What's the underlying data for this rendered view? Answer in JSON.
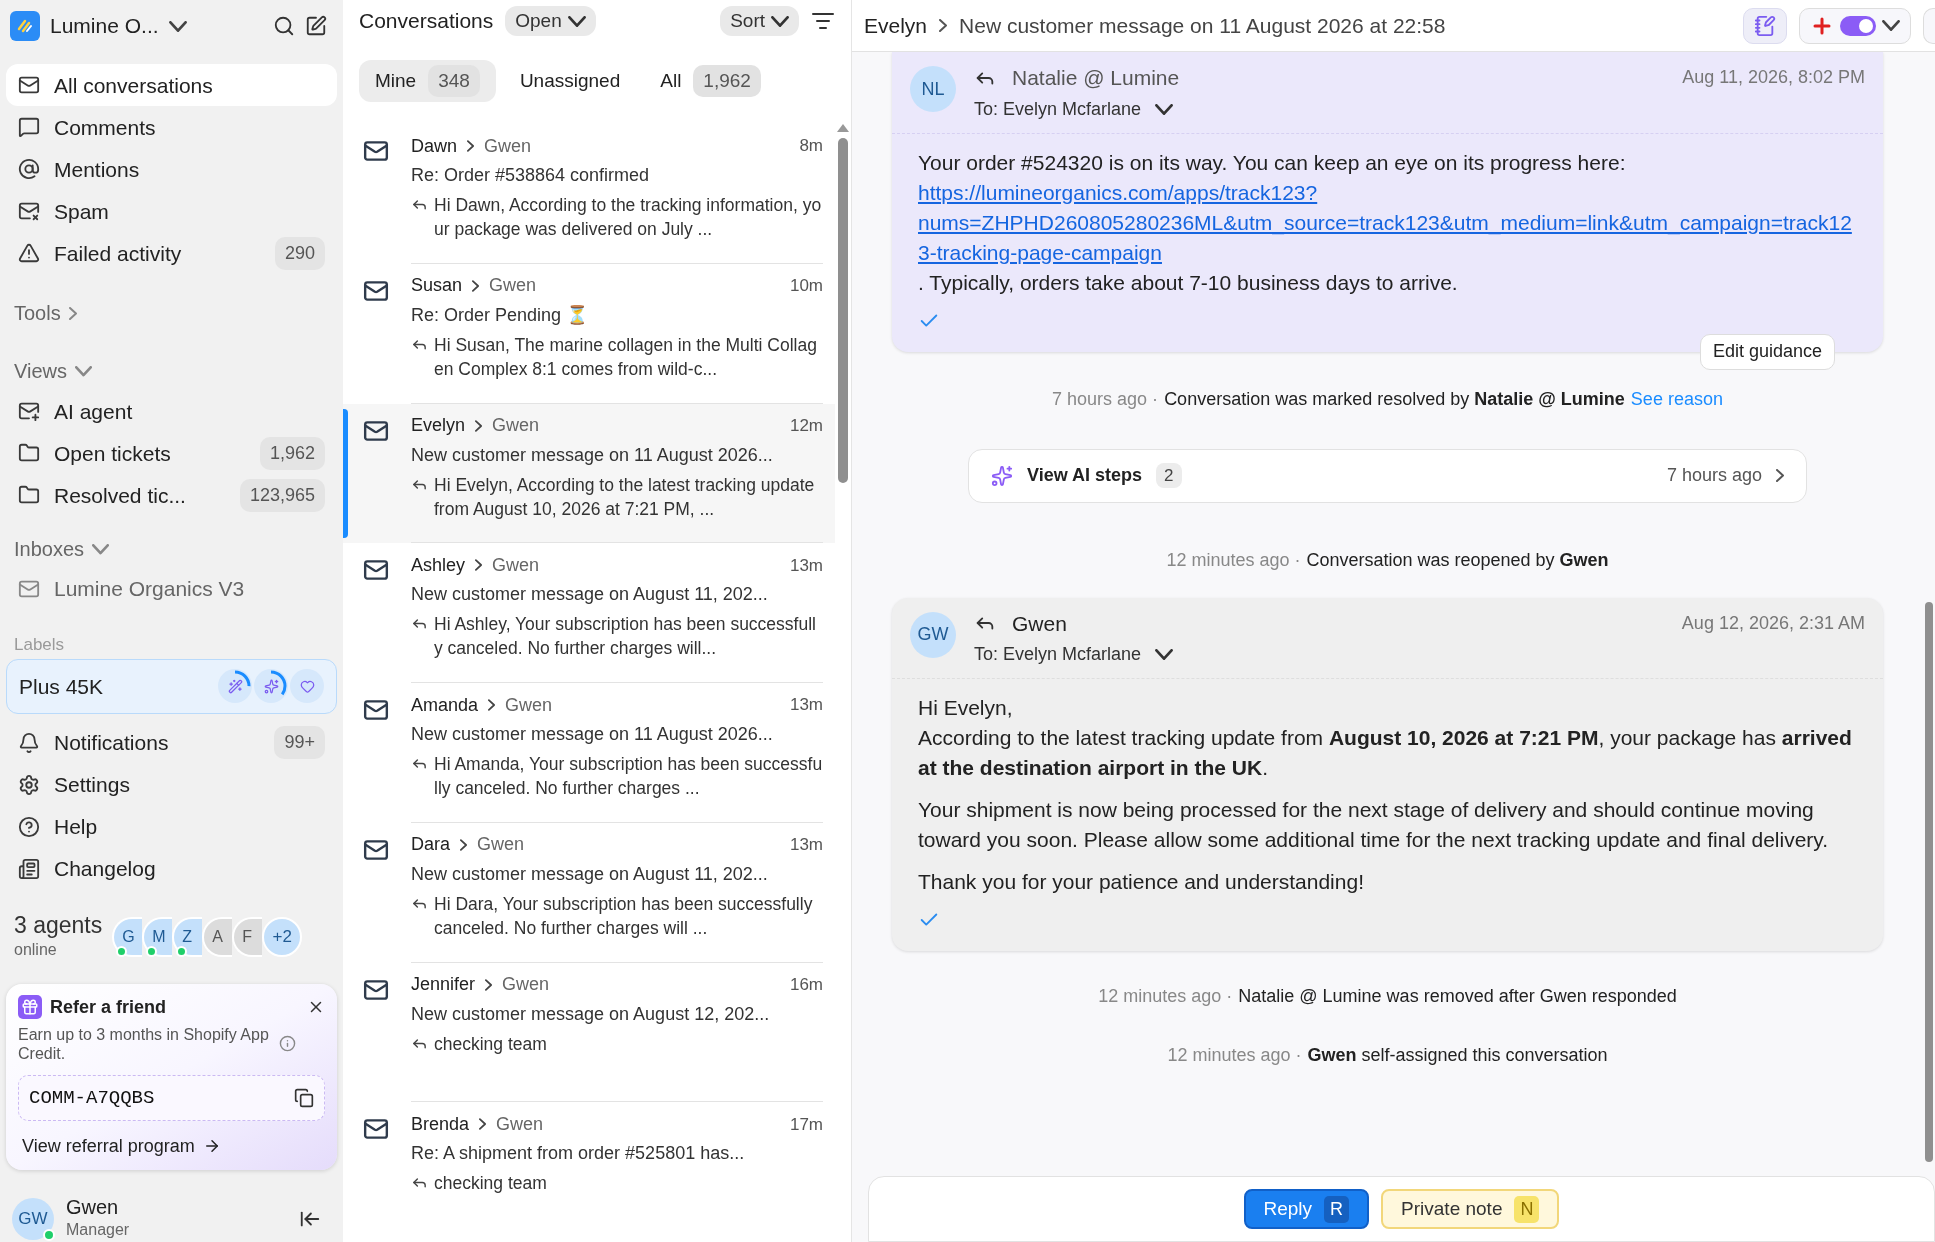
{
  "workspace": {
    "name": "Lumine O..."
  },
  "nav": [
    {
      "kind": "all",
      "label": "All conversations",
      "selected": true
    },
    {
      "kind": "comments",
      "label": "Comments",
      "selected": false
    },
    {
      "kind": "mentions",
      "label": "Mentions",
      "selected": false
    },
    {
      "kind": "spam",
      "label": "Spam",
      "selected": false
    },
    {
      "kind": "failed",
      "label": "Failed activity",
      "count": "290",
      "selected": false
    }
  ],
  "tools": {
    "label": "Tools"
  },
  "views": {
    "label": "Views",
    "items": [
      {
        "kind": "ai",
        "label": "AI agent"
      },
      {
        "kind": "folder",
        "label": "Open tickets",
        "count": "1,962"
      },
      {
        "kind": "folder",
        "label": "Resolved tic...",
        "count": "123,965"
      }
    ]
  },
  "inboxes": {
    "label": "Inboxes",
    "items": [
      {
        "label": "Lumine Organics V3"
      }
    ]
  },
  "labels": {
    "label": "Labels"
  },
  "plan": {
    "label": "Plus 45K"
  },
  "bottom_nav": [
    {
      "kind": "bell",
      "label": "Notifications",
      "count": "99+"
    },
    {
      "kind": "gear",
      "label": "Settings"
    },
    {
      "kind": "help",
      "label": "Help"
    },
    {
      "kind": "changelog",
      "label": "Changelog"
    }
  ],
  "agents": {
    "count": "3 agents",
    "status": "online",
    "avatars": [
      {
        "initials": "G",
        "online": true
      },
      {
        "initials": "M",
        "online": true
      },
      {
        "initials": "Z",
        "online": true
      },
      {
        "initials": "A",
        "online": false
      },
      {
        "initials": "F",
        "online": false
      }
    ],
    "more": "+2"
  },
  "referral": {
    "title": "Refer a friend",
    "text": "Earn up to 3 months in Shopify App Credit.",
    "code": "COMM-A7QQBS",
    "link": "View referral program"
  },
  "user": {
    "initials": "GW",
    "name": "Gwen",
    "role": "Manager",
    "online": true
  },
  "list": {
    "title": "Conversations",
    "status": "Open",
    "sort": "Sort",
    "tabs": [
      {
        "label": "Mine",
        "count": "348",
        "selected": true
      },
      {
        "label": "Unassigned",
        "selected": false
      },
      {
        "label": "All",
        "count": "1,962",
        "selected": false
      }
    ],
    "conversations": [
      {
        "from": "Dawn",
        "to": "Gwen",
        "time": "8m",
        "subject": "Re: Order #538864 confirmed",
        "preview": "Hi Dawn, According to the tracking information, your package was delivered on July ...",
        "selected": false
      },
      {
        "from": "Susan",
        "to": "Gwen",
        "time": "10m",
        "subject": "Re: Order Pending ⏳",
        "preview": "Hi Susan, The marine collagen in the Multi Collagen Complex 8:1 comes from wild-c...",
        "selected": false
      },
      {
        "from": "Evelyn",
        "to": "Gwen",
        "time": "12m",
        "subject": "New customer message on 11 August 2026...",
        "preview": "Hi Evelyn, According to the latest tracking update from August 10, 2026 at 7:21 PM, ...",
        "selected": true
      },
      {
        "from": "Ashley",
        "to": "Gwen",
        "time": "13m",
        "subject": "New customer message on August 11, 202...",
        "preview": "Hi Ashley, Your subscription has been successfully canceled. No further charges will...",
        "selected": false
      },
      {
        "from": "Amanda",
        "to": "Gwen",
        "time": "13m",
        "subject": "New customer message on 11 August 2026...",
        "preview": "Hi Amanda, Your subscription has been successfully canceled. No further charges ...",
        "selected": false
      },
      {
        "from": "Dara",
        "to": "Gwen",
        "time": "13m",
        "subject": "New customer message on August 11, 202...",
        "preview": "Hi Dara, Your subscription has been successfully canceled. No further charges will ...",
        "selected": false
      },
      {
        "from": "Jennifer",
        "to": "Gwen",
        "time": "16m",
        "subject": "New customer message on August 12, 202...",
        "preview": "checking team",
        "selected": false
      },
      {
        "from": "Brenda",
        "to": "Gwen",
        "time": "17m",
        "subject": "Re: A shipment from order #525801 has...",
        "preview": "checking team",
        "selected": false
      }
    ]
  },
  "thread": {
    "customer": "Evelyn",
    "title": "New customer message on 11 August 2026 at 22:58",
    "toggle": {
      "on": true
    },
    "events": [
      {
        "kind": "message",
        "highlighted": true,
        "initials": "NL",
        "author": "Natalie @ Lumine",
        "to": "To: Evelyn Mcfarlane",
        "time": "Aug 11, 2026, 8:02 PM",
        "delivered": true,
        "action": "Edit guidance",
        "paragraphs": [
          [
            [
              {
                "kind": "text",
                "text": "Your order #524320 is on its way. You can keep an eye on its progress here: "
              },
              {
                "kind": "link",
                "text": "https://lumineorganics.com/apps/track123?nums=ZHPHD260805280236ML&utm_source=track123&utm_medium=link&utm_campaign=track123-tracking-page-campaign"
              },
              {
                "kind": "text",
                "text": ". Typically, orders take about 7-10 business days to arrive."
              }
            ]
          ]
        ]
      },
      {
        "kind": "activity",
        "time": "7 hours ago ·",
        "text": "Conversation was marked resolved by **Natalie @ Lumine**",
        "link": "See reason"
      },
      {
        "kind": "ai_steps",
        "label": "View AI steps",
        "count": "2",
        "time": "7 hours ago"
      },
      {
        "kind": "activity",
        "time": "12 minutes ago ·",
        "text": "Conversation was reopened by **Gwen**"
      },
      {
        "kind": "message",
        "highlighted": false,
        "initials": "GW",
        "author": "Gwen",
        "to": "To: Evelyn Mcfarlane",
        "time": "Aug 12, 2026, 2:31 AM",
        "delivered": true,
        "paragraphs": [
          [
            [
              {
                "kind": "text",
                "text": "Hi Evelyn,"
              }
            ],
            [
              {
                "kind": "text",
                "text": "According to the latest tracking update from **August 10, 2026 at 7:21 PM**, your package has **arrived at the destination airport in the UK**."
              }
            ]
          ],
          [
            [
              {
                "kind": "text",
                "text": "Your shipment is now being processed for the next stage of delivery and should continue moving toward you soon. Please allow some additional time for the next tracking update and final delivery."
              }
            ]
          ],
          [
            [
              {
                "kind": "text",
                "text": "Thank you for your patience and understanding!"
              }
            ]
          ]
        ]
      },
      {
        "kind": "activity",
        "time": "12 minutes ago ·",
        "text": "Natalie @ Lumine was removed after Gwen responded"
      },
      {
        "kind": "activity",
        "time": "12 minutes ago ·",
        "text": "**Gwen** self-assigned this conversation"
      }
    ],
    "composer": [
      {
        "kind": "reply",
        "label": "Reply",
        "shortcut": "R"
      },
      {
        "kind": "note",
        "label": "Private note",
        "shortcut": "N"
      }
    ]
  }
}
